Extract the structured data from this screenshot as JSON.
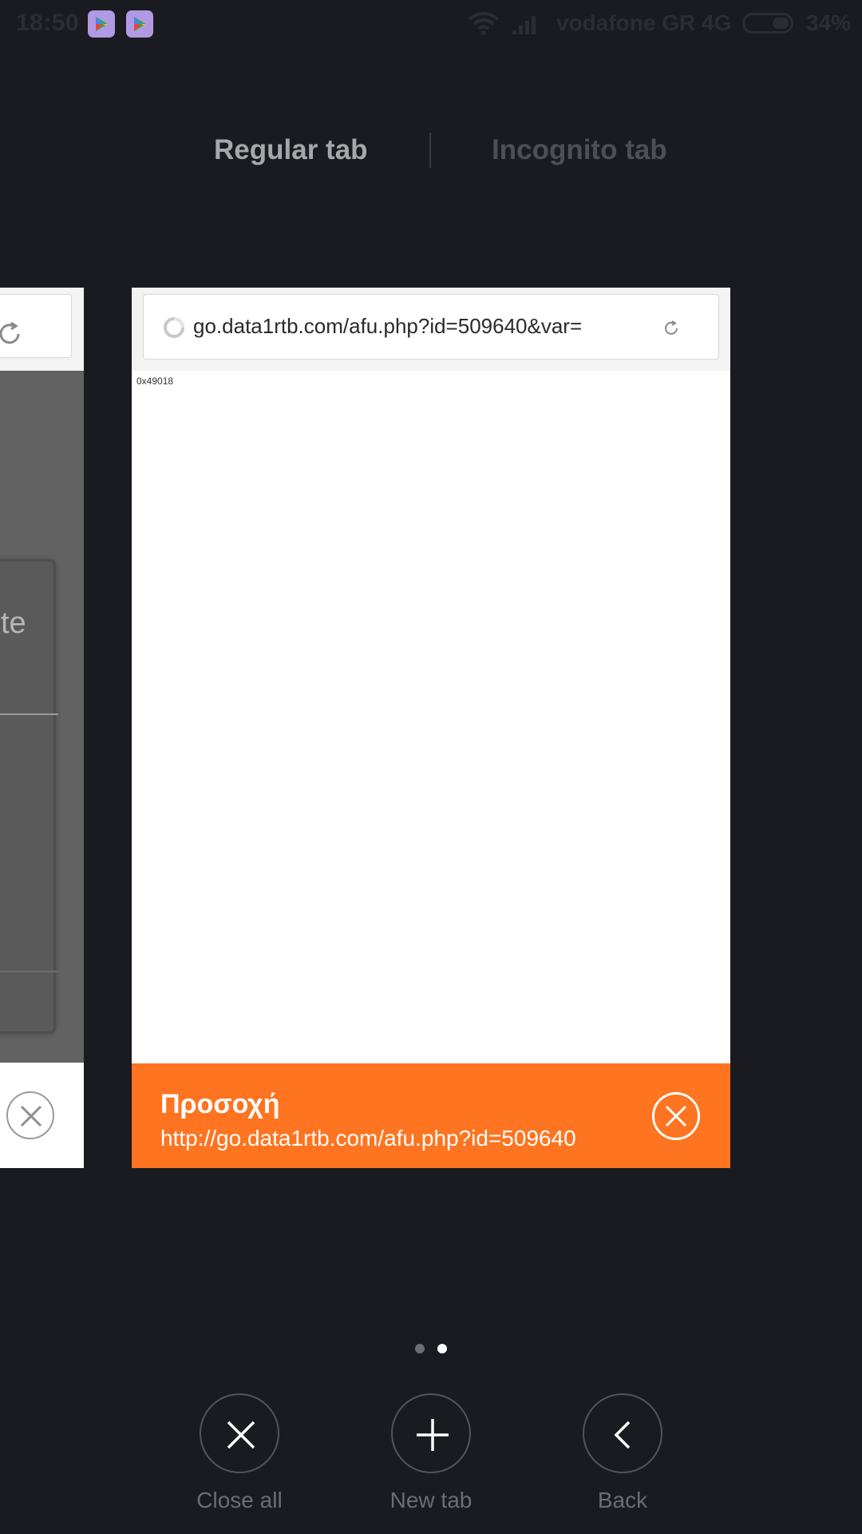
{
  "status_bar": {
    "time": "18:50",
    "carrier": "vodafone GR 4G",
    "battery": "34%",
    "battery_level": 0.34
  },
  "tab_switch": {
    "regular_label": "Regular tab",
    "incognito_label": "Incognito tab",
    "active": "Regular tab"
  },
  "left_tab": {
    "dialog_partial_text": "te"
  },
  "current_tab": {
    "url": "go.data1rtb.com/afu.php?id=509640&var=",
    "page_text": "0x49018",
    "warning": {
      "title": "Προσοχή",
      "url": "http://go.data1rtb.com/afu.php?id=509640"
    }
  },
  "pager": {
    "total": 2,
    "current": 2
  },
  "actions": [
    {
      "label": "Close all",
      "icon": "close-icon"
    },
    {
      "label": "New tab",
      "icon": "plus-icon"
    },
    {
      "label": "Back",
      "icon": "chevron-left-icon"
    }
  ],
  "colors": {
    "background": "#1a1b20",
    "warning_banner": "#fe7420",
    "status_icon": "#b19ae3"
  }
}
